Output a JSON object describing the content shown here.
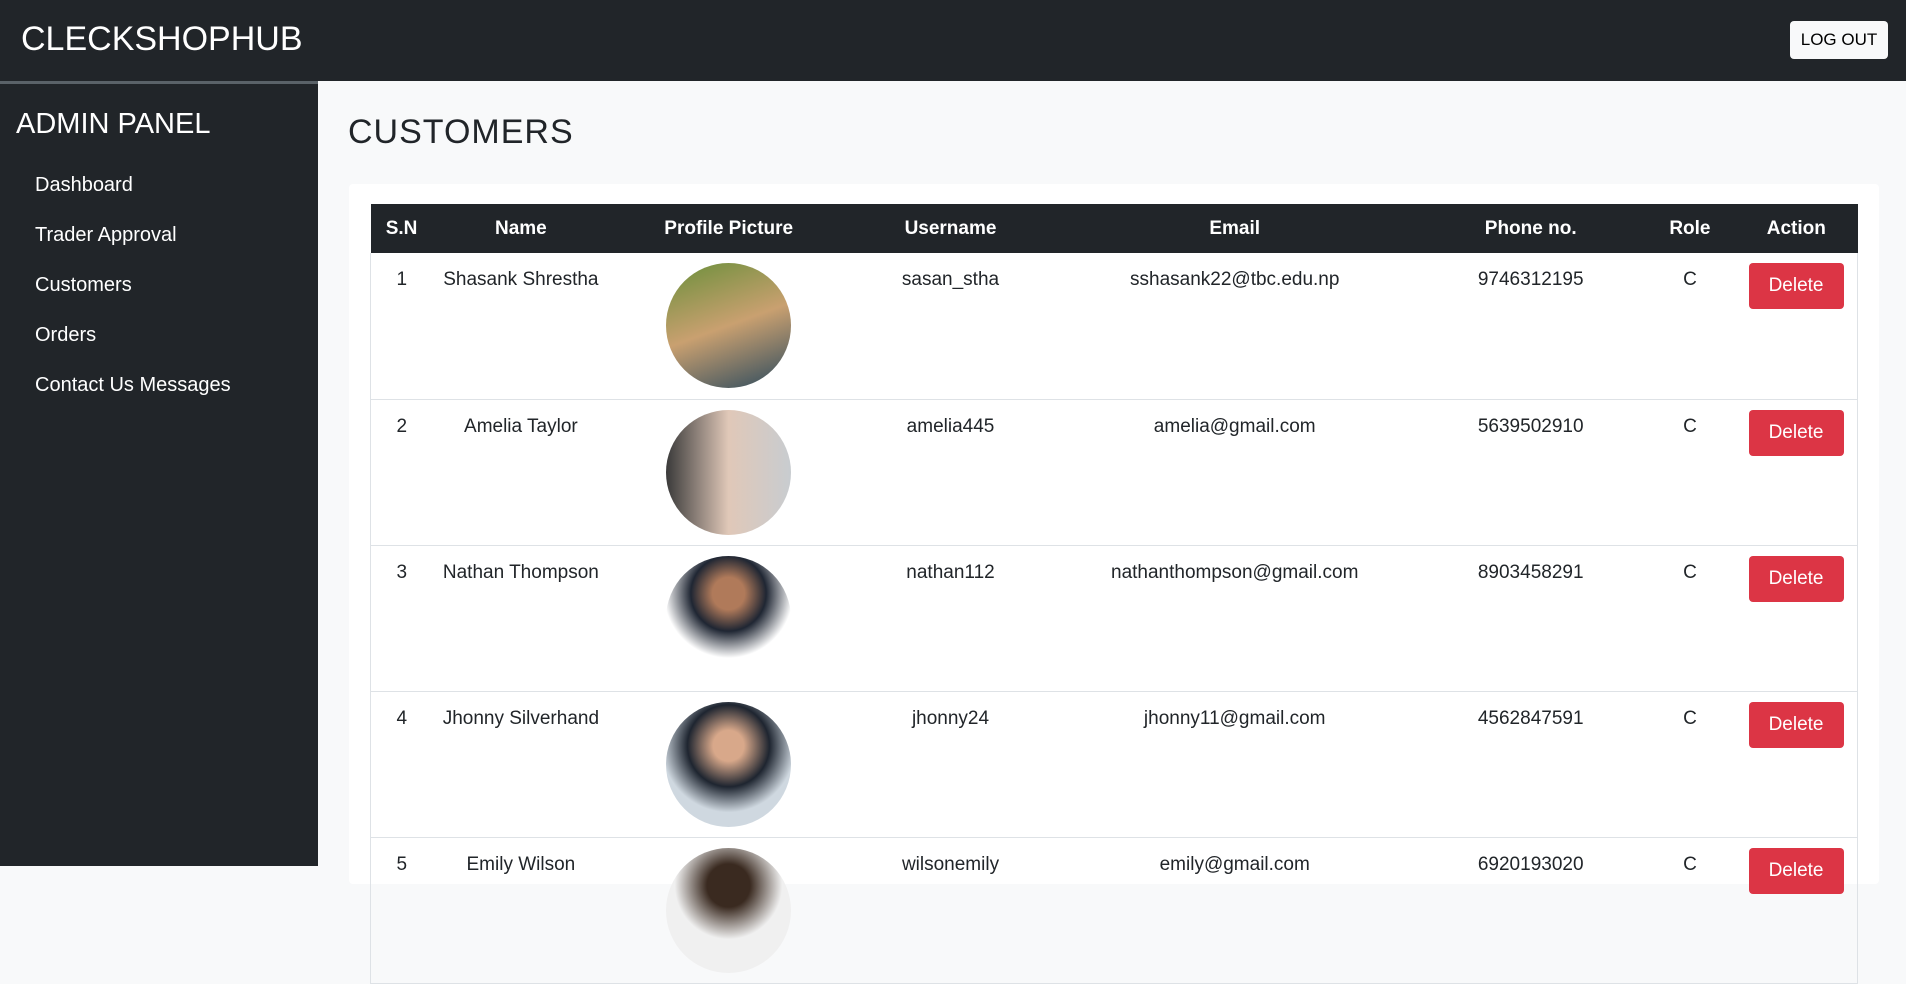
{
  "navbar": {
    "brand": "CLECKSHOPHUB",
    "logout_label": "LOG OUT"
  },
  "sidebar": {
    "title": "ADMIN PANEL",
    "items": [
      {
        "label": "Dashboard"
      },
      {
        "label": "Trader Approval"
      },
      {
        "label": "Customers"
      },
      {
        "label": "Orders"
      },
      {
        "label": "Contact Us Messages"
      }
    ]
  },
  "main": {
    "title": "CUSTOMERS"
  },
  "table": {
    "headers": [
      "S.N",
      "Name",
      "Profile Picture",
      "Username",
      "Email",
      "Phone no.",
      "Role",
      "Action"
    ],
    "rows": [
      {
        "sn": "1",
        "name": "Shasank Shrestha",
        "username": "sasan_stha",
        "email": "sshasank22@tbc.edu.np",
        "phone": "9746312195",
        "role": "C",
        "action": "Delete",
        "avatar": "linear-gradient(160deg,#6a8f3a,#c9a070 50%,#2c4a5e)"
      },
      {
        "sn": "2",
        "name": "Amelia Taylor",
        "username": "amelia445",
        "email": "amelia@gmail.com",
        "phone": "5639502910",
        "role": "C",
        "action": "Delete",
        "avatar": "linear-gradient(90deg,#3a3a3a,#e0c8b8 50%,#c8ccd0)"
      },
      {
        "sn": "3",
        "name": "Nathan Thompson",
        "username": "nathan112",
        "email": "nathanthompson@gmail.com",
        "phone": "8903458291",
        "role": "C",
        "action": "Delete",
        "avatar": "radial-gradient(circle at 50% 30%,#b07a5a 15%,#1f2633 35%,#ffffff 60%)"
      },
      {
        "sn": "4",
        "name": "Jhonny Silverhand",
        "username": "jhonny24",
        "email": "jhonny11@gmail.com",
        "phone": "4562847591",
        "role": "C",
        "action": "Delete",
        "avatar": "radial-gradient(circle at 50% 35%,#d8a88a 15%,#1e2530 40%,#cfd8e0 65%)"
      },
      {
        "sn": "5",
        "name": "Emily Wilson",
        "username": "wilsonemily",
        "email": "emily@gmail.com",
        "phone": "6920193020",
        "role": "C",
        "action": "Delete",
        "avatar": "radial-gradient(circle at 50% 30%,#3a2a20 20%,#f0f0f0 50%)"
      }
    ]
  },
  "colors": {
    "navbar": "#212529",
    "danger": "#dc3545",
    "background": "#f8f9fa"
  }
}
